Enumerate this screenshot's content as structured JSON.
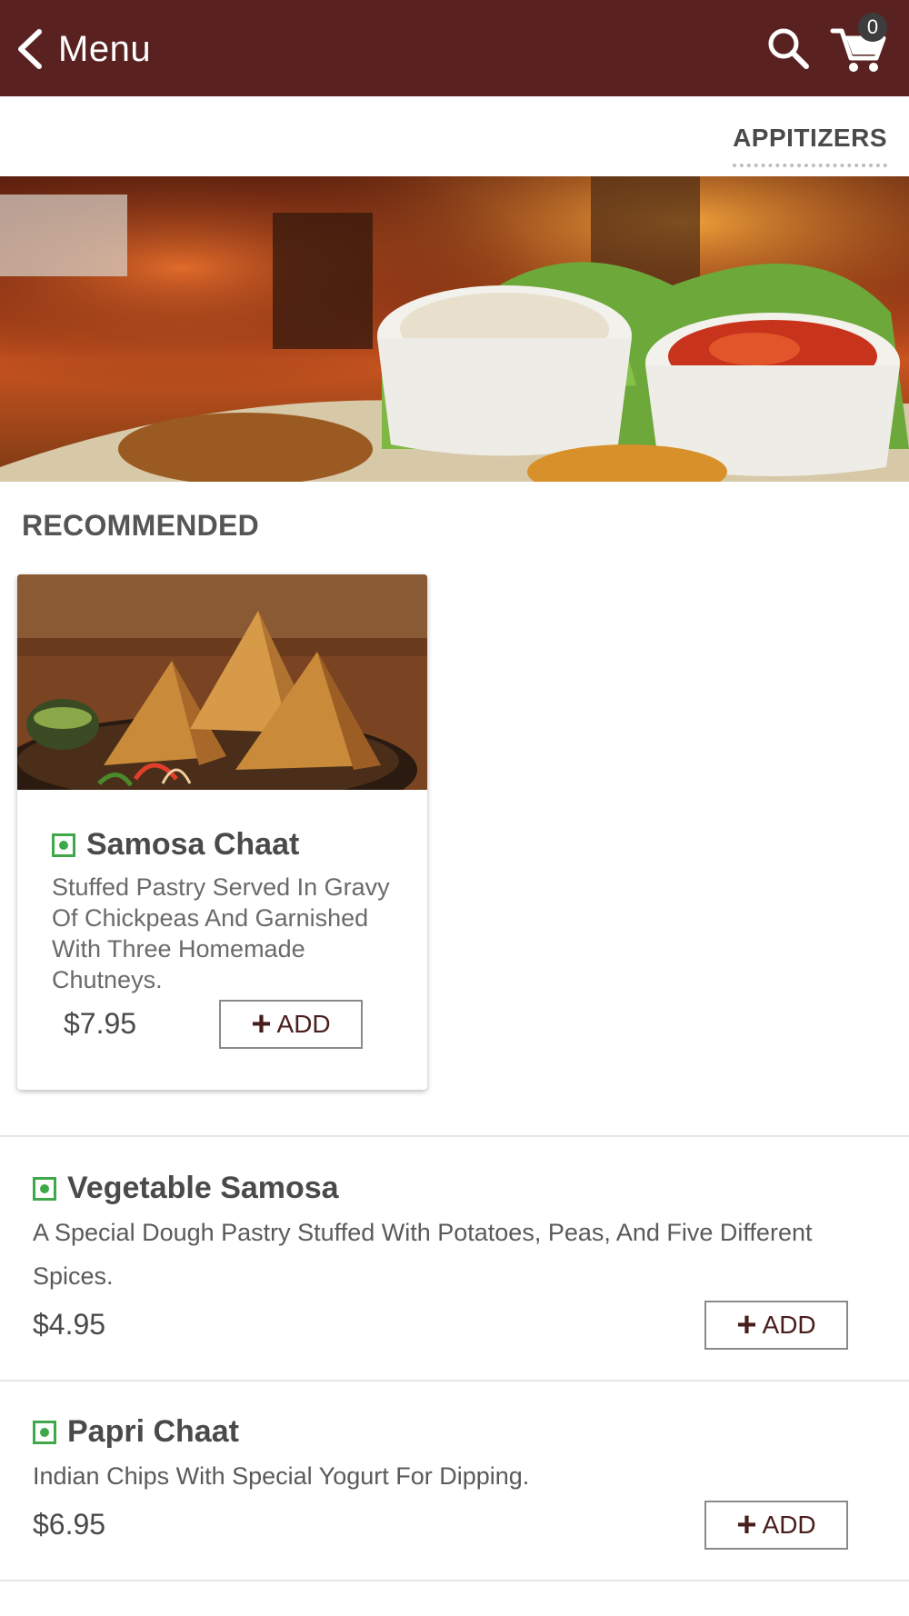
{
  "header": {
    "back_label": "Menu",
    "cart_count": "0",
    "colors": {
      "bar": "#5a2121",
      "badge": "#3d3d3d"
    }
  },
  "category_tab": {
    "label": "APPITIZERS"
  },
  "recommended": {
    "title": "RECOMMENDED",
    "card": {
      "name": "Samosa Chaat",
      "description": "Stuffed Pastry Served In Gravy Of Chickpeas And Garnished With Three Homemade Chutneys.",
      "price": "$7.95",
      "add_label": "ADD",
      "veg_color": "#3fa84a"
    }
  },
  "items": [
    {
      "name": "Vegetable Samosa",
      "description": "A Special Dough Pastry Stuffed With Potatoes, Peas, And Five Different Spices.",
      "price": "$4.95",
      "add_label": "ADD"
    },
    {
      "name": "Papri Chaat",
      "description": "Indian Chips With Special Yogurt For Dipping.",
      "price": "$6.95",
      "add_label": "ADD"
    }
  ],
  "icons": [
    "back-chevron-icon",
    "search-icon",
    "cart-icon",
    "veg-indicator-icon",
    "plus-icon"
  ]
}
